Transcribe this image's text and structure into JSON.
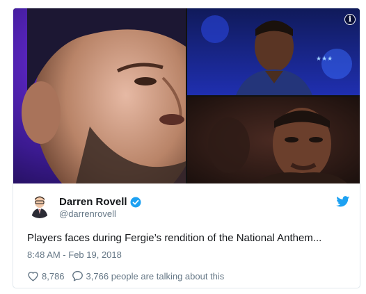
{
  "tweet": {
    "author": {
      "display_name": "Darren Rovell",
      "handle": "@darrenrovell",
      "verified": true
    },
    "text": "Players faces during Fergie’s rendition of the National Anthem...",
    "timestamp": "8:48 AM - Feb 19, 2018",
    "actions": {
      "like_count": "8,786",
      "conversation_text": "3,766 people are talking about this"
    },
    "media": {
      "photos": [
        "photo-left",
        "photo-top-right",
        "photo-bottom-right"
      ],
      "info_icon": "info-icon"
    }
  },
  "colors": {
    "twitter_blue": "#1da1f2",
    "text_primary": "#14171a",
    "text_secondary": "#657786",
    "border": "#e1e8ed"
  }
}
